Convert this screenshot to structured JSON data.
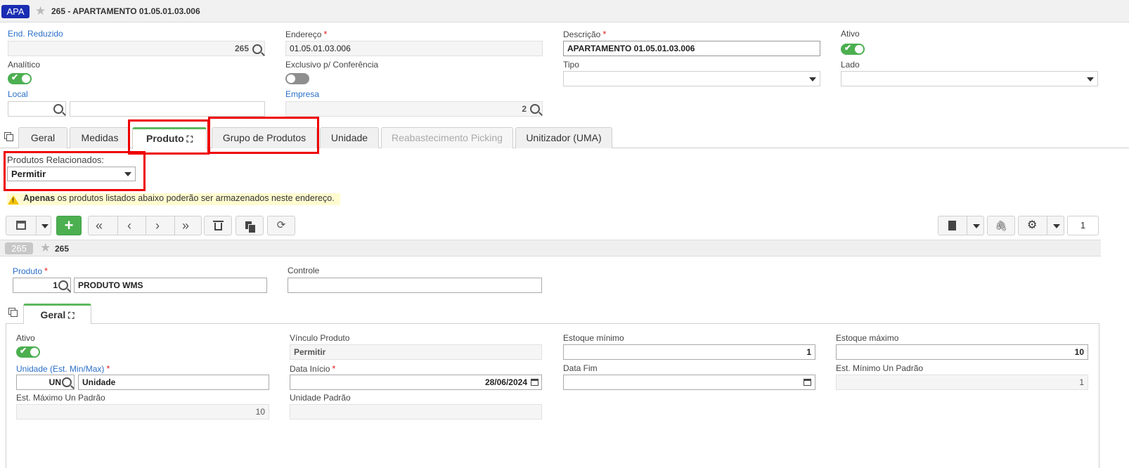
{
  "header": {
    "badge": "APA",
    "title": "265 - APARTAMENTO 01.05.01.03.006"
  },
  "form": {
    "end_reduzido": {
      "label": "End. Reduzido",
      "value": "265"
    },
    "endereco": {
      "label": "Endereço",
      "value": "01.05.01.03.006"
    },
    "descricao": {
      "label": "Descrição",
      "value": "APARTAMENTO 01.05.01.03.006"
    },
    "ativo": {
      "label": "Ativo",
      "on": true
    },
    "analitico": {
      "label": "Analítico",
      "on": true
    },
    "exclusivo": {
      "label": "Exclusivo p/ Conferência",
      "on": false
    },
    "tipo": {
      "label": "Tipo",
      "value": ""
    },
    "lado": {
      "label": "Lado",
      "value": ""
    },
    "local": {
      "label": "Local",
      "value": "",
      "desc": ""
    },
    "empresa": {
      "label": "Empresa",
      "value": "2"
    }
  },
  "tabs": [
    {
      "label": "Geral"
    },
    {
      "label": "Medidas"
    },
    {
      "label": "Produto",
      "active": true
    },
    {
      "label": "Grupo de Produtos"
    },
    {
      "label": "Unidade"
    },
    {
      "label": "Reabastecimento Picking",
      "disabled": true
    },
    {
      "label": "Unitizador (UMA)"
    }
  ],
  "produtos_relacionados": {
    "label": "Produtos Relacionados:",
    "value": "Permitir"
  },
  "warning": {
    "bold": "Apenas",
    "text": " os produtos listados abaixo poderão ser armazenados neste endereço."
  },
  "toolbar": {
    "page_number": "1"
  },
  "record": {
    "badge": "265",
    "title": "265"
  },
  "detail": {
    "produto": {
      "label": "Produto",
      "code": "1",
      "desc": "PRODUTO WMS"
    },
    "controle": {
      "label": "Controle",
      "value": ""
    },
    "tab": {
      "label": "Geral"
    },
    "ativo": {
      "label": "Ativo",
      "on": true
    },
    "vinculo": {
      "label": "Vínculo Produto",
      "value": "Permitir"
    },
    "estoque_minimo": {
      "label": "Estoque mínimo",
      "value": "1"
    },
    "estoque_maximo": {
      "label": "Estoque máximo",
      "value": "10"
    },
    "unidade": {
      "label": "Unidade (Est. Min/Max)",
      "code": "UN",
      "desc": "Unidade"
    },
    "data_inicio": {
      "label": "Data Início",
      "value": "28/06/2024"
    },
    "data_fim": {
      "label": "Data Fim",
      "value": ""
    },
    "est_min_padrao": {
      "label": "Est. Mínimo Un Padrão",
      "value": "1"
    },
    "est_max_padrao": {
      "label": "Est. Máximo Un Padrão",
      "value": "10"
    },
    "unidade_padrao": {
      "label": "Unidade Padrão",
      "value": ""
    }
  },
  "colors": {
    "accent": "#1a2db3",
    "green": "#4caf50",
    "highlight": "#ee0000",
    "warning_bg": "#fffbd0"
  }
}
